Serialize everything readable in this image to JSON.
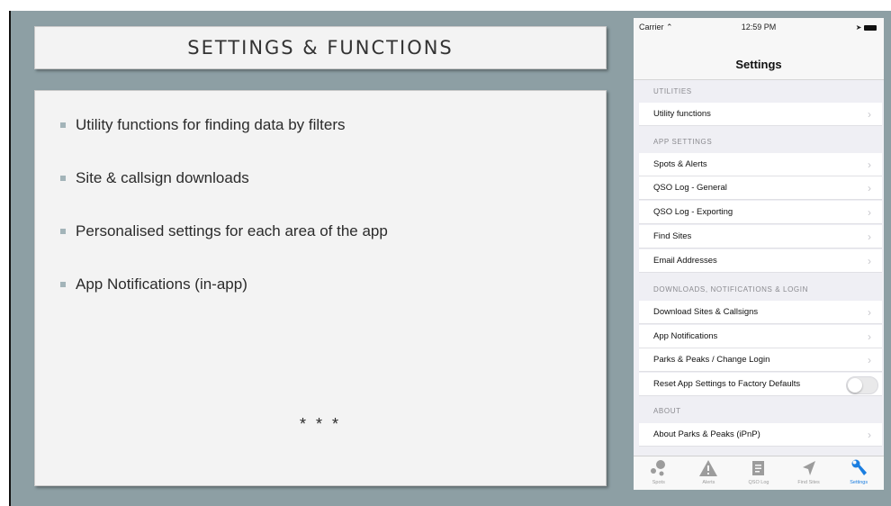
{
  "slide": {
    "title": "SETTINGS & FUNCTIONS",
    "bullets": [
      "Utility functions for finding data by filters",
      "Site & callsign downloads",
      "Personalised settings for each area of the app",
      "App Notifications (in-app)"
    ],
    "stars": "* * *"
  },
  "phone": {
    "status": {
      "carrier": "Carrier",
      "time": "12:59 PM"
    },
    "nav_title": "Settings",
    "sections": [
      {
        "header": "UTILITIES",
        "rows": [
          "Utility functions"
        ]
      },
      {
        "header": "APP SETTINGS",
        "rows": [
          "Spots & Alerts",
          "QSO Log - General",
          "QSO Log - Exporting",
          "Find Sites",
          "Email Addresses"
        ]
      },
      {
        "header": "DOWNLOADS, NOTIFICATIONS & LOGIN",
        "rows": [
          "Download Sites & Callsigns",
          "App Notifications",
          "Parks & Peaks / Change Login",
          "Reset App Settings to Factory Defaults"
        ]
      },
      {
        "header": "ABOUT",
        "rows": [
          "About Parks & Peaks (iPnP)"
        ]
      }
    ],
    "reset_toggle_on": false,
    "tabs": [
      {
        "label": "Spots",
        "icon": "spots-icon"
      },
      {
        "label": "Alerts",
        "icon": "alert-triangle-icon"
      },
      {
        "label": "QSO Log",
        "icon": "log-icon"
      },
      {
        "label": "Find Sites",
        "icon": "location-arrow-icon"
      },
      {
        "label": "Settings",
        "icon": "wrench-icon"
      }
    ],
    "active_tab": "Settings",
    "colors": {
      "accent": "#1b7ee0",
      "slide_bg": "#8d9fa4",
      "bullet": "#a3b4b9"
    }
  }
}
